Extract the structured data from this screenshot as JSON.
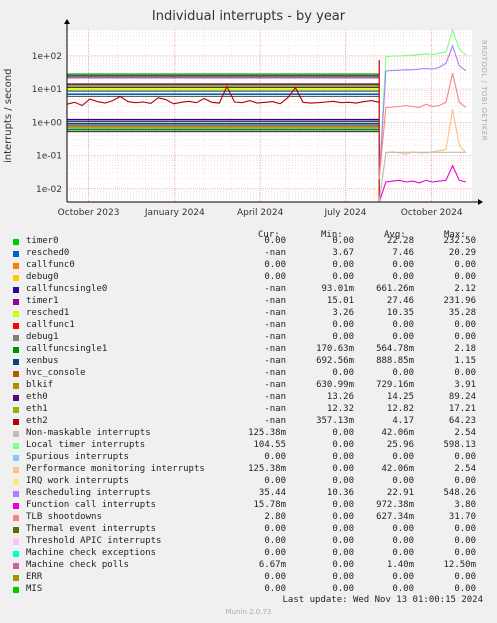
{
  "title": "Individual interrupts - by year",
  "side_text": "RRDTOOL / TOBI OETIKER",
  "footer": "Munin 2.0.73",
  "last_update": "Last update: Wed Nov 13 01:00:15 2024",
  "legend_headers": {
    "cur": "Cur:",
    "min": "Min:",
    "avg": "Avg:",
    "max": "Max:"
  },
  "legend": [
    {
      "name": "timer0",
      "color": "#00cc00",
      "cur": "0.00",
      "min": "0.00",
      "avg": "22.28",
      "max": "232.50"
    },
    {
      "name": "resched0",
      "color": "#0066b3",
      "cur": "-nan",
      "min": "3.67",
      "avg": "7.46",
      "max": "20.29"
    },
    {
      "name": "callfunc0",
      "color": "#ff8000",
      "cur": "0.00",
      "min": "0.00",
      "avg": "0.00",
      "max": "0.00"
    },
    {
      "name": "debug0",
      "color": "#ffcc00",
      "cur": "0.00",
      "min": "0.00",
      "avg": "0.00",
      "max": "0.00"
    },
    {
      "name": "callfuncsingle0",
      "color": "#330099",
      "cur": "-nan",
      "min": "93.01m",
      "avg": "661.26m",
      "max": "2.12"
    },
    {
      "name": "timer1",
      "color": "#990099",
      "cur": "-nan",
      "min": "15.01",
      "avg": "27.46",
      "max": "231.96"
    },
    {
      "name": "resched1",
      "color": "#ccff00",
      "cur": "-nan",
      "min": "3.26",
      "avg": "10.35",
      "max": "35.28"
    },
    {
      "name": "callfunc1",
      "color": "#ff0000",
      "cur": "-nan",
      "min": "0.00",
      "avg": "0.00",
      "max": "0.00"
    },
    {
      "name": "debug1",
      "color": "#808080",
      "cur": "-nan",
      "min": "0.00",
      "avg": "0.00",
      "max": "0.00"
    },
    {
      "name": "callfuncsingle1",
      "color": "#008f00",
      "cur": "-nan",
      "min": "170.63m",
      "avg": "564.78m",
      "max": "2.18"
    },
    {
      "name": "xenbus",
      "color": "#00487d",
      "cur": "-nan",
      "min": "692.56m",
      "avg": "888.85m",
      "max": "1.15"
    },
    {
      "name": "hvc_console",
      "color": "#b35a00",
      "cur": "-nan",
      "min": "0.00",
      "avg": "0.00",
      "max": "0.00"
    },
    {
      "name": "blkif",
      "color": "#b38f00",
      "cur": "-nan",
      "min": "630.99m",
      "avg": "729.16m",
      "max": "3.91"
    },
    {
      "name": "eth0",
      "color": "#6b006b",
      "cur": "-nan",
      "min": "13.26",
      "avg": "14.25",
      "max": "89.24"
    },
    {
      "name": "eth1",
      "color": "#8fb300",
      "cur": "-nan",
      "min": "12.32",
      "avg": "12.82",
      "max": "17.21"
    },
    {
      "name": "eth2",
      "color": "#b30000",
      "cur": "-nan",
      "min": "357.13m",
      "avg": "4.17",
      "max": "64.23"
    },
    {
      "name": "Non-maskable interrupts",
      "color": "#bebebe",
      "cur": "125.38m",
      "min": "0.00",
      "avg": "42.06m",
      "max": "2.54"
    },
    {
      "name": "Local timer interrupts",
      "color": "#80ff80",
      "cur": "104.55",
      "min": "0.00",
      "avg": "25.96",
      "max": "598.13"
    },
    {
      "name": "Spurious interrupts",
      "color": "#80c9ff",
      "cur": "0.00",
      "min": "0.00",
      "avg": "0.00",
      "max": "0.00"
    },
    {
      "name": "Performance monitoring interrupts",
      "color": "#ffc080",
      "cur": "125.38m",
      "min": "0.00",
      "avg": "42.06m",
      "max": "2.54"
    },
    {
      "name": "IRQ work interrupts",
      "color": "#ffe680",
      "cur": "0.00",
      "min": "0.00",
      "avg": "0.00",
      "max": "0.00"
    },
    {
      "name": "Rescheduling interrupts",
      "color": "#aa80ff",
      "cur": "35.44",
      "min": "10.36",
      "avg": "22.91",
      "max": "548.26"
    },
    {
      "name": "Function call interrupts",
      "color": "#ee00cc",
      "cur": "15.78m",
      "min": "0.00",
      "avg": "972.38m",
      "max": "3.80"
    },
    {
      "name": "TLB shootdowns",
      "color": "#ff8080",
      "cur": "2.80",
      "min": "0.00",
      "avg": "627.34m",
      "max": "31.70"
    },
    {
      "name": "Thermal event interrupts",
      "color": "#666600",
      "cur": "0.00",
      "min": "0.00",
      "avg": "0.00",
      "max": "0.00"
    },
    {
      "name": "Threshold APIC interrupts",
      "color": "#ffbfff",
      "cur": "0.00",
      "min": "0.00",
      "avg": "0.00",
      "max": "0.00"
    },
    {
      "name": "Machine check exceptions",
      "color": "#00ffcc",
      "cur": "0.00",
      "min": "0.00",
      "avg": "0.00",
      "max": "0.00"
    },
    {
      "name": "Machine check polls",
      "color": "#cc6699",
      "cur": "6.67m",
      "min": "0.00",
      "avg": "1.40m",
      "max": "12.50m"
    },
    {
      "name": "ERR",
      "color": "#999900",
      "cur": "0.00",
      "min": "0.00",
      "avg": "0.00",
      "max": "0.00"
    },
    {
      "name": "MIS",
      "color": "#00cc00",
      "cur": "0.00",
      "min": "0.00",
      "avg": "0.00",
      "max": "0.00"
    }
  ],
  "chart_data": {
    "type": "line",
    "ylabel": "interrupts / second",
    "yscale": "log",
    "ylim": [
      0.004,
      600
    ],
    "yticks": [
      "1e-02",
      "1e-01",
      "1e+00",
      "1e+01",
      "1e+02"
    ],
    "xticks": [
      "October 2023",
      "January 2024",
      "April 2024",
      "July 2024",
      "October 2024"
    ],
    "x_range": [
      "2023-09-08",
      "2024-11-13"
    ],
    "x_tick_dates": [
      "2023-10-01",
      "2024-01-01",
      "2024-04-01",
      "2024-07-01",
      "2024-10-01"
    ],
    "switch_date": "2024-08-06",
    "grid": true,
    "series_old": [
      {
        "name": "timer0",
        "color": "#00cc00",
        "value": 28
      },
      {
        "name": "timer1",
        "color": "#990099",
        "value": 25
      },
      {
        "name": "eth0",
        "color": "#6b006b",
        "value": 14
      },
      {
        "name": "eth1",
        "color": "#8fb300",
        "value": 12.8
      },
      {
        "name": "resched1",
        "color": "#ccff00",
        "value": 10
      },
      {
        "name": "resched0",
        "color": "#0066b3",
        "value": 7
      },
      {
        "name": "xenbus",
        "color": "#00487d",
        "value": 0.9
      },
      {
        "name": "blkif",
        "color": "#b38f00",
        "value": 0.72
      },
      {
        "name": "callfuncsingle0",
        "color": "#330099",
        "value": 1.2
      },
      {
        "name": "callfuncsingle1",
        "color": "#008f00",
        "value": 0.6
      }
    ],
    "series_new": [
      {
        "name": "Local timer interrupts",
        "color": "#80ff80",
        "values": [
          0.02,
          95,
          98,
          100,
          102,
          105,
          110,
          115,
          110,
          120,
          130,
          600,
          160,
          104.55
        ]
      },
      {
        "name": "Rescheduling interrupts",
        "color": "#aa80ff",
        "values": [
          0.02,
          35,
          36,
          37,
          38,
          38,
          40,
          42,
          40,
          45,
          60,
          200,
          50,
          35.44
        ]
      },
      {
        "name": "TLB shootdowns",
        "color": "#ff8080",
        "values": [
          0.02,
          2.8,
          2.9,
          3.0,
          3.2,
          3.0,
          2.8,
          3.5,
          3.0,
          3.2,
          4,
          30,
          4,
          2.8
        ]
      },
      {
        "name": "Performance monitoring interrupts",
        "color": "#ffc080",
        "values": [
          0.004,
          0.12,
          0.13,
          0.12,
          0.11,
          0.13,
          0.12,
          0.12,
          0.13,
          0.14,
          0.15,
          2.5,
          0.2,
          0.12
        ]
      },
      {
        "name": "Function call interrupts",
        "color": "#ee00cc",
        "values": [
          0.004,
          0.016,
          0.017,
          0.018,
          0.016,
          0.017,
          0.015,
          0.018,
          0.016,
          0.017,
          0.018,
          0.05,
          0.018,
          0.016
        ]
      },
      {
        "name": "Non-maskable interrupts",
        "color": "#bebebe",
        "values": [
          0.004,
          0.125,
          0.125,
          0.125,
          0.125,
          0.125,
          0.125,
          0.125,
          0.125,
          0.125,
          0.125,
          0.125,
          0.125,
          0.125
        ]
      }
    ],
    "eth2_values": [
      3.5,
      4.0,
      3.2,
      5.0,
      4.2,
      3.8,
      4.5,
      6.0,
      4.2,
      3.9,
      4.1,
      3.7,
      5.5,
      4.8,
      3.6,
      4.0,
      4.3,
      3.9,
      5.2,
      4.0,
      3.8,
      12,
      4.1,
      3.9,
      4.5,
      3.8,
      4.0,
      4.2,
      3.6,
      5.5,
      11,
      4.0,
      3.8,
      3.9,
      4.1,
      4.3,
      3.9,
      4.0,
      3.8,
      4.2,
      4.5,
      4.0
    ]
  }
}
